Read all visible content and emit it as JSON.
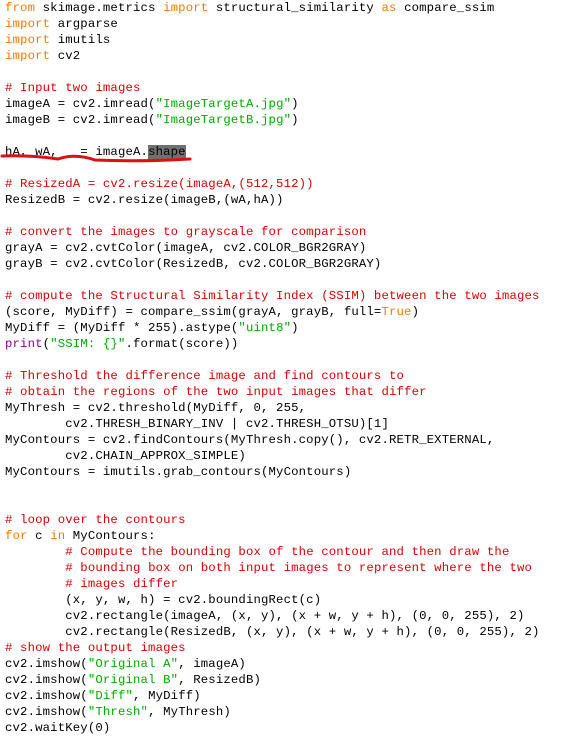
{
  "editor": {
    "lines": [
      [
        {
          "t": "from",
          "c": "kw"
        },
        {
          "t": " skimage.metrics "
        },
        {
          "t": "import",
          "c": "kw"
        },
        {
          "t": " structural_similarity "
        },
        {
          "t": "as",
          "c": "kw"
        },
        {
          "t": " compare_ssim"
        }
      ],
      [
        {
          "t": "import",
          "c": "kw"
        },
        {
          "t": " argparse"
        }
      ],
      [
        {
          "t": "import",
          "c": "kw"
        },
        {
          "t": " imutils"
        }
      ],
      [
        {
          "t": "import",
          "c": "kw"
        },
        {
          "t": " cv2"
        }
      ],
      [],
      [
        {
          "t": "# Input two images",
          "c": "cm"
        }
      ],
      [
        {
          "t": "imageA = cv2.imread("
        },
        {
          "t": "\"ImageTargetA.jpg\"",
          "c": "str"
        },
        {
          "t": ")"
        }
      ],
      [
        {
          "t": "imageB = cv2.imread("
        },
        {
          "t": "\"ImageTargetB.jpg\"",
          "c": "str"
        },
        {
          "t": ")"
        }
      ],
      [],
      [
        {
          "t": "hA, wA, _ = imageA."
        },
        {
          "t": "shape",
          "c": "hl"
        }
      ],
      [],
      [
        {
          "t": "# ResizedA = cv2.resize(imageA,(512,512))",
          "c": "cm"
        }
      ],
      [
        {
          "t": "ResizedB = cv2.resize(imageB,(wA,hA))"
        }
      ],
      [],
      [
        {
          "t": "# convert the images to grayscale for comparison",
          "c": "cm"
        }
      ],
      [
        {
          "t": "grayA = cv2.cvtColor(imageA, cv2.COLOR_BGR2GRAY)"
        }
      ],
      [
        {
          "t": "grayB = cv2.cvtColor(ResizedB, cv2.COLOR_BGR2GRAY)"
        }
      ],
      [],
      [
        {
          "t": "# compute the Structural Similarity Index (SSIM) between the two images",
          "c": "cm"
        }
      ],
      [
        {
          "t": "(score, MyDiff) = compare_ssim(grayA, grayB, full="
        },
        {
          "t": "True",
          "c": "kw"
        },
        {
          "t": ")"
        }
      ],
      [
        {
          "t": "MyDiff = (MyDiff * 255).astype("
        },
        {
          "t": "\"uint8\"",
          "c": "str"
        },
        {
          "t": ")"
        }
      ],
      [
        {
          "t": "print",
          "c": "bi"
        },
        {
          "t": "("
        },
        {
          "t": "\"SSIM: {}\"",
          "c": "str"
        },
        {
          "t": ".format(score))"
        }
      ],
      [],
      [
        {
          "t": "# Threshold the difference image and find contours to",
          "c": "cm"
        }
      ],
      [
        {
          "t": "# obtain the regions of the two input images that differ",
          "c": "cm"
        }
      ],
      [
        {
          "t": "MyThresh = cv2.threshold(MyDiff, 0, 255,"
        }
      ],
      [
        {
          "t": "        cv2.THRESH_BINARY_INV | cv2.THRESH_OTSU)[1]"
        }
      ],
      [
        {
          "t": "MyContours = cv2.findContours(MyThresh.copy(), cv2.RETR_EXTERNAL,"
        }
      ],
      [
        {
          "t": "        cv2.CHAIN_APPROX_SIMPLE)"
        }
      ],
      [
        {
          "t": "MyContours = imutils.grab_contours(MyContours)"
        }
      ],
      [],
      [],
      [
        {
          "t": "# loop over the contours",
          "c": "cm"
        }
      ],
      [
        {
          "t": "for",
          "c": "kw"
        },
        {
          "t": " c "
        },
        {
          "t": "in",
          "c": "kw"
        },
        {
          "t": " MyContours:"
        }
      ],
      [
        {
          "t": "        "
        },
        {
          "t": "# Compute the bounding box of the contour and then draw the",
          "c": "cm"
        }
      ],
      [
        {
          "t": "        "
        },
        {
          "t": "# bounding box on both input images to represent where the two",
          "c": "cm"
        }
      ],
      [
        {
          "t": "        "
        },
        {
          "t": "# images differ",
          "c": "cm"
        }
      ],
      [
        {
          "t": "        (x, y, w, h) = cv2.boundingRect(c)"
        }
      ],
      [
        {
          "t": "        cv2.rectangle(imageA, (x, y), (x + w, y + h), (0, 0, 255), 2)"
        }
      ],
      [
        {
          "t": "        cv2.rectangle(ResizedB, (x, y), (x + w, y + h), (0, 0, 255), 2)"
        }
      ],
      [
        {
          "t": "# show the output images",
          "c": "cm"
        }
      ],
      [
        {
          "t": "cv2.imshow("
        },
        {
          "t": "\"Original A\"",
          "c": "str"
        },
        {
          "t": ", imageA)"
        }
      ],
      [
        {
          "t": "cv2.imshow("
        },
        {
          "t": "\"Original B\"",
          "c": "str"
        },
        {
          "t": ", ResizedB)"
        }
      ],
      [
        {
          "t": "cv2.imshow("
        },
        {
          "t": "\"Diff\"",
          "c": "str"
        },
        {
          "t": ", MyDiff)"
        }
      ],
      [
        {
          "t": "cv2.imshow("
        },
        {
          "t": "\"Thresh\"",
          "c": "str"
        },
        {
          "t": ", MyThresh)"
        }
      ],
      [
        {
          "t": "cv2.waitKey(0)"
        }
      ]
    ],
    "annotation": {
      "type": "hand-drawn underline",
      "color": "#dd1111",
      "target_line": 10
    }
  }
}
